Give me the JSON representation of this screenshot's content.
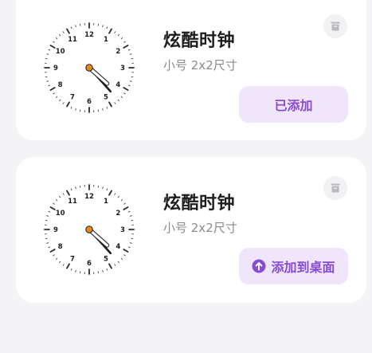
{
  "colors": {
    "background": "#f4f4f7",
    "card": "#ffffff",
    "accent": "#8a4bd4",
    "accent_bg": "#efe6fc",
    "title": "#1d1d1f",
    "subtitle": "#8a8a8f",
    "clock_center": "#e8891a"
  },
  "widgets": [
    {
      "title": "炫酷时钟",
      "subtitle": "小号 2x2尺寸",
      "action_label": "已添加",
      "action_icon": "",
      "delete_icon": "trash-icon",
      "clock": {
        "numerals": [
          "12",
          "1",
          "2",
          "3",
          "4",
          "5",
          "6",
          "7",
          "8",
          "9",
          "10",
          "11"
        ],
        "hour": 4,
        "minute": 23,
        "second": 0
      }
    },
    {
      "title": "炫酷时钟",
      "subtitle": "小号 2x2尺寸",
      "action_label": "添加到桌面",
      "action_icon": "arrow-up-circle-icon",
      "delete_icon": "trash-icon",
      "clock": {
        "numerals": [
          "12",
          "1",
          "2",
          "3",
          "4",
          "5",
          "6",
          "7",
          "8",
          "9",
          "10",
          "11"
        ],
        "hour": 4,
        "minute": 23,
        "second": 0
      }
    }
  ]
}
